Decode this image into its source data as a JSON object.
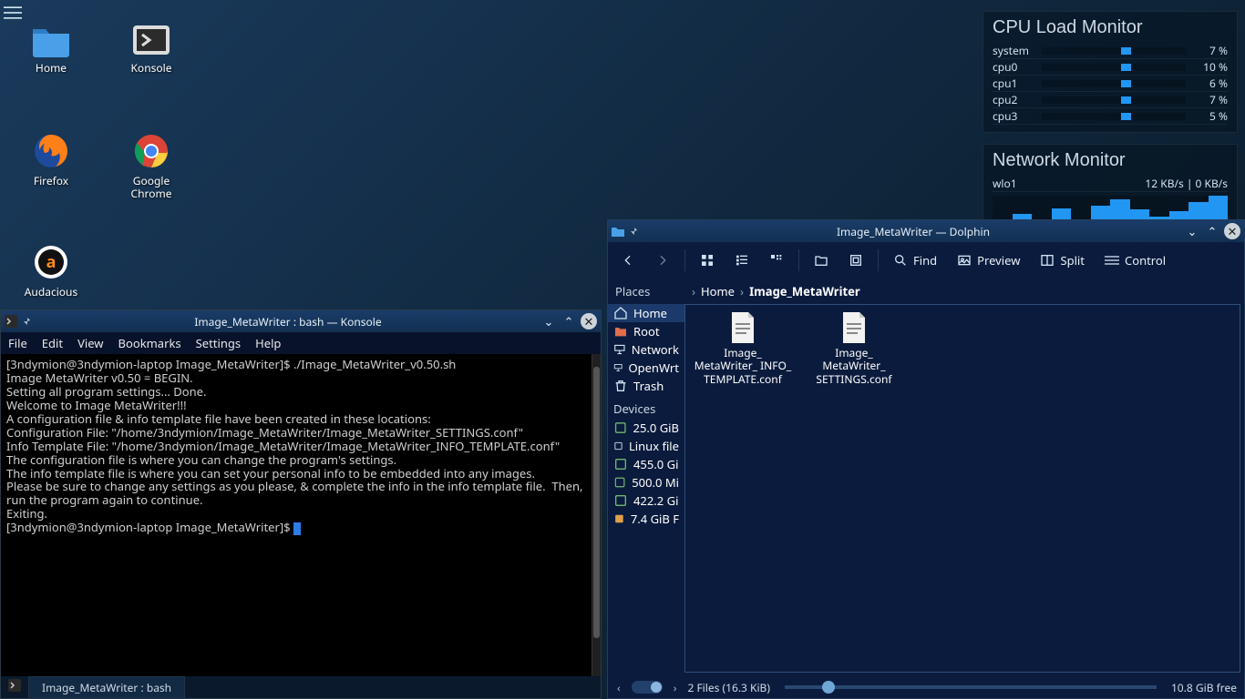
{
  "desktop": {
    "icons": [
      {
        "label": "Home"
      },
      {
        "label": "Konsole"
      },
      {
        "label": "Firefox"
      },
      {
        "label": "Google Chrome"
      },
      {
        "label": "Audacious"
      }
    ]
  },
  "cpu_widget": {
    "title": "CPU Load Monitor",
    "rows": [
      {
        "label": "system",
        "value": "7 %"
      },
      {
        "label": "cpu0",
        "value": "10 %"
      },
      {
        "label": "cpu1",
        "value": "6 %"
      },
      {
        "label": "cpu2",
        "value": "7 %"
      },
      {
        "label": "cpu3",
        "value": "5 %"
      }
    ]
  },
  "net_widget": {
    "title": "Network Monitor",
    "iface": "wlo1",
    "rate": "12 KB/s | 0 KB/s"
  },
  "konsole": {
    "title": "Image_MetaWriter : bash — Konsole",
    "menubar": [
      "File",
      "Edit",
      "View",
      "Bookmarks",
      "Settings",
      "Help"
    ],
    "tab": "Image_MetaWriter : bash",
    "lines": [
      "[3ndymion@3ndymion-laptop Image_MetaWriter]$ ./Image_MetaWriter_v0.50.sh",
      "",
      "Image MetaWriter v0.50 = BEGIN.",
      "",
      "Setting all program settings... Done.",
      "",
      "Welcome to Image MetaWriter!!!",
      "A configuration file & info template file have been created in these locations:",
      "",
      "Configuration File: \"/home/3ndymion/Image_MetaWriter/Image_MetaWriter_SETTINGS.conf\"",
      "Info Template File: \"/home/3ndymion/Image_MetaWriter/Image_MetaWriter_INFO_TEMPLATE.conf\"",
      "",
      "The configuration file is where you can change the program's settings.",
      "The info template file is where you can set your personal info to be embedded into any images.",
      "",
      "Please be sure to change any settings as you please, & complete the info in the info template file.  Then, run the program again to continue.",
      "",
      "Exiting.",
      "[3ndymion@3ndymion-laptop Image_MetaWriter]$ "
    ]
  },
  "dolphin": {
    "title": "Image_MetaWriter — Dolphin",
    "toolbar": {
      "find": "Find",
      "preview": "Preview",
      "split": "Split",
      "control": "Control"
    },
    "places_header": "Places",
    "breadcrumb": {
      "home": "Home",
      "current": "Image_MetaWriter"
    },
    "places": [
      {
        "label": "Home",
        "active": true
      },
      {
        "label": "Root"
      },
      {
        "label": "Network"
      },
      {
        "label": "OpenWrt"
      },
      {
        "label": "Trash"
      }
    ],
    "devices_header": "Devices",
    "devices": [
      {
        "label": "25.0 GiB"
      },
      {
        "label": "Linux file"
      },
      {
        "label": "455.0 Gi"
      },
      {
        "label": "500.0 Mi"
      },
      {
        "label": "422.2 Gi"
      },
      {
        "label": "7.4 GiB F"
      }
    ],
    "files": [
      {
        "label": "Image_\nMetaWriter_\nINFO_\nTEMPLATE.conf"
      },
      {
        "label": "Image_\nMetaWriter_\nSETTINGS.conf"
      }
    ],
    "status": {
      "summary": "2 Files (16.3 KiB)",
      "free": "10.8 GiB free"
    }
  }
}
